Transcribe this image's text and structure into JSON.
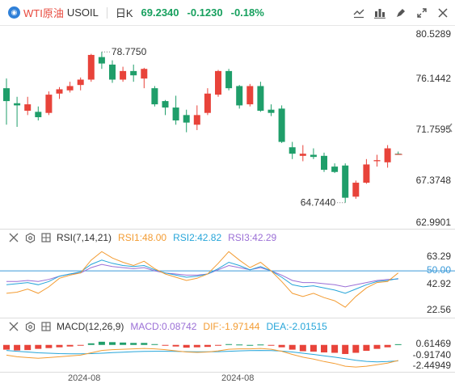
{
  "header": {
    "symbol_name": "WTI原油",
    "symbol_code": "USOIL",
    "interval": "日K",
    "price": "69.2340",
    "change": "-0.1230",
    "change_pct": "-0.18%",
    "tools": [
      "draw-line-icon",
      "indicator-icon",
      "brush-icon",
      "expand-icon",
      "close-icon"
    ]
  },
  "main": {
    "y_labels": [
      "80.5289",
      "76.1442",
      "71.7595",
      "67.3748",
      "62.9901"
    ],
    "high_marker": "78.7750",
    "low_marker": "64.7440"
  },
  "rsi": {
    "name": "RSI(7,14,21)",
    "rsi1": "RSI1:48.00",
    "rsi2": "RSI2:42.82",
    "rsi3": "RSI3:42.29",
    "y_labels": [
      "63.29",
      "50.00",
      "42.92",
      "22.56"
    ]
  },
  "macd": {
    "name": "MACD(12,26,9)",
    "macd": "MACD:0.08742",
    "dif": "DIF:-1.97144",
    "dea": "DEA:-2.01515",
    "y_labels": [
      "0.61469",
      "-0.91740",
      "-2.44949"
    ]
  },
  "x_labels": [
    "2024-08",
    "2024-08"
  ],
  "colors": {
    "up": "#e8433a",
    "down": "#1f9e6a",
    "rsi1": "#f39c33",
    "rsi2": "#26a5d9",
    "rsi3": "#9b6fd6",
    "macd_dif": "#f39c33",
    "macd_dea": "#26a5d9",
    "baseline": "#3b9ad9"
  },
  "chart_data": {
    "type": "candlestick",
    "price_range": [
      62.9901,
      80.5289
    ],
    "candles": [
      {
        "o": 75.4,
        "h": 76.3,
        "c": 74.2,
        "l": 72.0
      },
      {
        "o": 74.0,
        "h": 74.6,
        "c": 73.8,
        "l": 71.8
      },
      {
        "o": 73.3,
        "h": 74.6,
        "c": 73.9,
        "l": 72.9
      },
      {
        "o": 73.2,
        "h": 73.7,
        "c": 72.7,
        "l": 72.4
      },
      {
        "o": 73.1,
        "h": 75.1,
        "c": 74.8,
        "l": 72.9
      },
      {
        "o": 74.9,
        "h": 75.5,
        "c": 75.3,
        "l": 74.4
      },
      {
        "o": 75.2,
        "h": 76.0,
        "c": 75.6,
        "l": 75.0
      },
      {
        "o": 75.7,
        "h": 76.4,
        "c": 76.2,
        "l": 75.2
      },
      {
        "o": 76.2,
        "h": 78.6,
        "c": 78.5,
        "l": 76.0
      },
      {
        "o": 78.3,
        "h": 78.78,
        "c": 77.7,
        "l": 77.2
      },
      {
        "o": 77.6,
        "h": 78.0,
        "c": 76.2,
        "l": 75.9
      },
      {
        "o": 76.2,
        "h": 77.4,
        "c": 77.0,
        "l": 76.0
      },
      {
        "o": 77.0,
        "h": 77.6,
        "c": 76.6,
        "l": 76.0
      },
      {
        "o": 76.3,
        "h": 77.3,
        "c": 77.2,
        "l": 75.4
      },
      {
        "o": 75.4,
        "h": 75.6,
        "c": 73.9,
        "l": 73.7
      },
      {
        "o": 74.2,
        "h": 74.3,
        "c": 73.6,
        "l": 72.9
      },
      {
        "o": 73.6,
        "h": 74.7,
        "c": 72.4,
        "l": 72.0
      },
      {
        "o": 72.9,
        "h": 73.4,
        "c": 72.2,
        "l": 71.3
      },
      {
        "o": 72.0,
        "h": 73.8,
        "c": 72.9,
        "l": 71.5
      },
      {
        "o": 73.1,
        "h": 75.4,
        "c": 74.9,
        "l": 72.9
      },
      {
        "o": 74.8,
        "h": 77.1,
        "c": 77.0,
        "l": 74.6
      },
      {
        "o": 77.0,
        "h": 77.2,
        "c": 75.4,
        "l": 75.2
      },
      {
        "o": 75.6,
        "h": 75.7,
        "c": 73.8,
        "l": 73.5
      },
      {
        "o": 73.9,
        "h": 75.8,
        "c": 75.6,
        "l": 73.7
      },
      {
        "o": 75.6,
        "h": 76.0,
        "c": 73.3,
        "l": 73.2
      },
      {
        "o": 73.4,
        "h": 73.9,
        "c": 73.1,
        "l": 72.8
      },
      {
        "o": 73.5,
        "h": 73.8,
        "c": 70.4,
        "l": 70.3
      },
      {
        "o": 69.9,
        "h": 70.4,
        "c": 69.3,
        "l": 68.8
      },
      {
        "o": 69.1,
        "h": 70.1,
        "c": 69.3,
        "l": 68.6
      },
      {
        "o": 69.2,
        "h": 69.8,
        "c": 69.0,
        "l": 68.8
      },
      {
        "o": 69.1,
        "h": 69.4,
        "c": 67.8,
        "l": 67.6
      },
      {
        "o": 68.1,
        "h": 68.4,
        "c": 67.6,
        "l": 67.5
      },
      {
        "o": 68.2,
        "h": 68.4,
        "c": 65.2,
        "l": 64.744
      },
      {
        "o": 65.3,
        "h": 66.8,
        "c": 66.6,
        "l": 65.1
      },
      {
        "o": 66.6,
        "h": 68.8,
        "c": 68.3,
        "l": 66.5
      },
      {
        "o": 68.6,
        "h": 69.2,
        "c": 68.7,
        "l": 68.1
      },
      {
        "o": 68.5,
        "h": 70.1,
        "c": 69.8,
        "l": 68.0
      },
      {
        "o": 69.3,
        "h": 69.5,
        "c": 69.23,
        "l": 69.2
      }
    ],
    "rsi_range": [
      10,
      75
    ],
    "rsi1": [
      29,
      30,
      33,
      29,
      35,
      43,
      46,
      48,
      60,
      68,
      62,
      58,
      55,
      59,
      52,
      47,
      44,
      41,
      43,
      47,
      57,
      68,
      60,
      53,
      58,
      50,
      40,
      29,
      26,
      29,
      25,
      22,
      16,
      26,
      34,
      39,
      40,
      48
    ],
    "rsi2": [
      37,
      38,
      39,
      37,
      40,
      45,
      47,
      49,
      56,
      60,
      57,
      55,
      54,
      55,
      51,
      48,
      46,
      44,
      45,
      47,
      52,
      58,
      55,
      51,
      54,
      50,
      44,
      37,
      35,
      36,
      34,
      32,
      29,
      33,
      37,
      40,
      41,
      42.82
    ],
    "rsi3": [
      40,
      40,
      41,
      40,
      42,
      45,
      47,
      48,
      53,
      56,
      54,
      53,
      52,
      53,
      50,
      48,
      47,
      46,
      46,
      47,
      51,
      55,
      53,
      51,
      53,
      50,
      46,
      41,
      39,
      39,
      38,
      37,
      35,
      37,
      39,
      41,
      42,
      42.29
    ],
    "rsi_baseline": 50.0,
    "macd_range": [
      -3.2,
      1.1
    ],
    "macd_hist": [
      -0.6,
      -0.7,
      -0.65,
      -0.5,
      -0.4,
      -0.3,
      -0.2,
      -0.05,
      0.2,
      0.4,
      0.35,
      0.3,
      0.25,
      0.25,
      0.1,
      -0.1,
      -0.2,
      -0.35,
      -0.3,
      -0.25,
      -0.1,
      0.1,
      0.05,
      0.0,
      0.05,
      -0.05,
      -0.3,
      -0.6,
      -0.8,
      -0.85,
      -0.95,
      -1.0,
      -1.15,
      -1.0,
      -0.75,
      -0.5,
      -0.3,
      0.09
    ],
    "macd_dif": [
      -1.3,
      -1.5,
      -1.6,
      -1.7,
      -1.6,
      -1.5,
      -1.4,
      -1.3,
      -1.0,
      -0.7,
      -0.6,
      -0.55,
      -0.5,
      -0.45,
      -0.5,
      -0.6,
      -0.75,
      -0.9,
      -0.95,
      -0.9,
      -0.75,
      -0.55,
      -0.5,
      -0.5,
      -0.45,
      -0.55,
      -0.8,
      -1.2,
      -1.55,
      -1.8,
      -2.1,
      -2.35,
      -2.7,
      -2.8,
      -2.7,
      -2.5,
      -2.3,
      -1.97
    ],
    "macd_dea": [
      -0.7,
      -0.8,
      -0.9,
      -1.0,
      -1.05,
      -1.1,
      -1.12,
      -1.12,
      -1.1,
      -1.05,
      -0.98,
      -0.92,
      -0.86,
      -0.82,
      -0.8,
      -0.8,
      -0.82,
      -0.86,
      -0.88,
      -0.88,
      -0.86,
      -0.8,
      -0.75,
      -0.72,
      -0.7,
      -0.72,
      -0.78,
      -0.9,
      -1.05,
      -1.2,
      -1.38,
      -1.55,
      -1.75,
      -1.95,
      -2.08,
      -2.15,
      -2.1,
      -2.02
    ]
  }
}
